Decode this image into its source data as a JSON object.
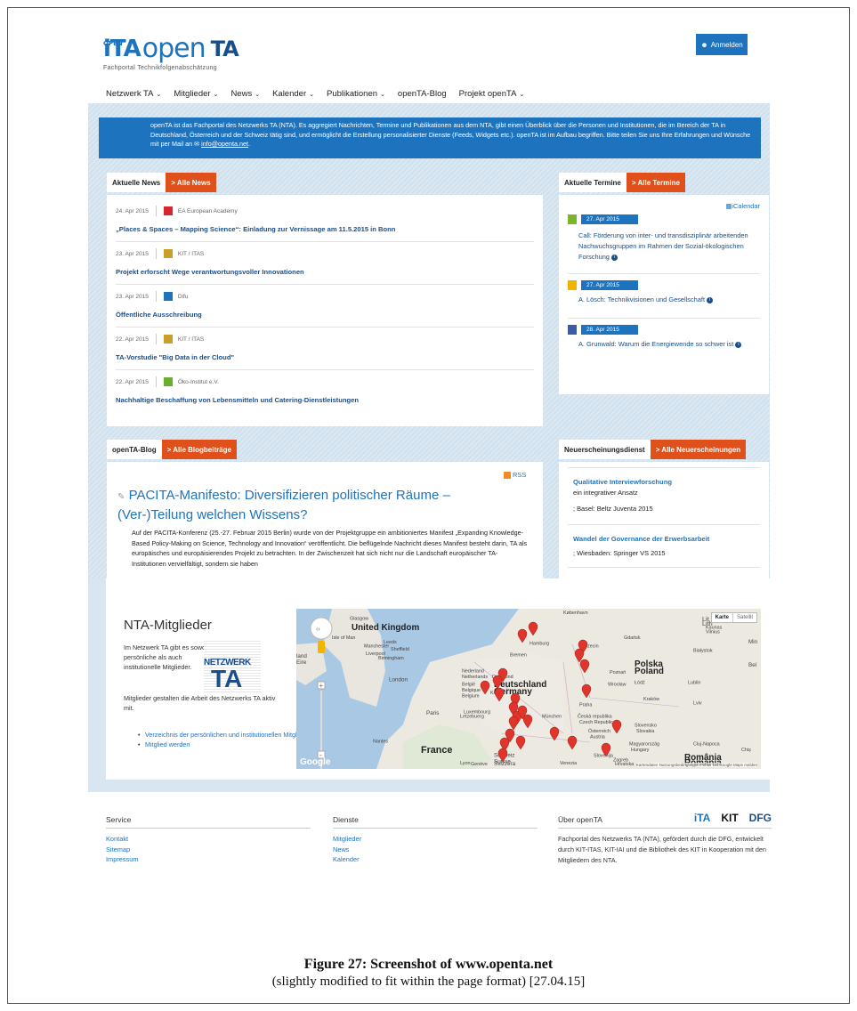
{
  "header": {
    "logo_small": "OPEN",
    "logo_ita": "iTA",
    "logo_open": "open",
    "logo_ta": "TA",
    "logo_sub": "Fachportal Technikfolgenabschätzung",
    "login_label": "Anmelden",
    "login_icon": "user-icon"
  },
  "nav": [
    {
      "label": "Netzwerk TA",
      "dropdown": true
    },
    {
      "label": "Mitglieder",
      "dropdown": true
    },
    {
      "label": "News",
      "dropdown": true
    },
    {
      "label": "Kalender",
      "dropdown": true
    },
    {
      "label": "Publikationen",
      "dropdown": true
    },
    {
      "label": "openTA-Blog",
      "dropdown": false
    },
    {
      "label": "Projekt openTA",
      "dropdown": true
    }
  ],
  "intro": {
    "text": "openTA ist das Fachportal des Netzwerks TA (NTA). Es aggregiert Nachrichten, Termine und Publikationen aus dem NTA, gibt einen Überblick über die Personen und Institutionen, die im Bereich der TA in Deutschland, Österreich und der Schweiz tätig sind, und ermöglicht die Erstellung personalisierter Dienste (Feeds, Widgets etc.). openTA ist im Aufbau begriffen. Bitte teilen Sie uns Ihre Erfahrungen und Wünsche mit per Mail an",
    "mail": "info@openta.net",
    "end": "."
  },
  "news": {
    "tab_label": "Aktuelle News",
    "tab_link": "> Alle News",
    "items": [
      {
        "date": "24. Apr 2015",
        "source": "EA European Academy",
        "title": "„Places & Spaces – Mapping Science“: Einladung zur Vernissage am 11.5.2015 in Bonn",
        "icon_color": "#d8262f"
      },
      {
        "date": "23. Apr 2015",
        "source": "KIT / ITAS",
        "title": "Projekt erforscht Wege verantwortungsvoller Innovationen",
        "icon_color": "#c8a028"
      },
      {
        "date": "23. Apr 2015",
        "source": "Difu",
        "title": "Öffentliche Ausschreibung",
        "icon_color": "#1e73be"
      },
      {
        "date": "22. Apr 2015",
        "source": "KIT / ITAS",
        "title": "TA-Vorstudie \"Big Data in der Cloud\"",
        "icon_color": "#c8a028"
      },
      {
        "date": "22. Apr 2015",
        "source": "Öko-Institut e.V.",
        "title": "Nachhaltige Beschaffung von Lebensmitteln und Catering-Dienstleistungen",
        "icon_color": "#6aae2e"
      }
    ]
  },
  "termine": {
    "tab_label": "Aktuelle Termine",
    "tab_link": "> Alle Termine",
    "ical": "iCalendar",
    "items": [
      {
        "date": "27. Apr 2015",
        "color": "#7db52a",
        "text": "Call: Förderung von inter- und transdisziplinär arbeitenden Nachwuchsgruppen im Rahmen der Sozial-ökologischen Forschung"
      },
      {
        "date": "27. Apr 2015",
        "color": "#f0b400",
        "text": "A. Lösch: Technikvisionen und Gesellschaft"
      },
      {
        "date": "28. Apr 2015",
        "color": "#3b5ba8",
        "text": "A. Grunwald: Warum die Energiewende so schwer ist"
      }
    ]
  },
  "blog": {
    "tab_label": "openTA-Blog",
    "tab_link": "> Alle Blogbeiträge",
    "rss": "RSS",
    "title": "PACITA-Manifesto: Diversifizieren politischer Räume – (Ver-)Teilung welchen Wissens?",
    "body": "Auf der PACITA-Konferenz (25.-27. Februar 2015 Berlin) wurde von der Projektgruppe ein ambitioniertes Manifest „Expanding Knowledge-Based Policy-Making on Science, Technology and Innovation“ veröffentlicht. Die beflügelnde Nachricht dieses Manifest besteht darin, TA als europäisches und europäisierendes Projekt zu betrachten. In der Zwischenzeit hat sich nicht nur die Landschaft europäischer TA-Institutionen vervielfältigt, sondern sie haben"
  },
  "pubs": {
    "tab_label": "Neuerscheinungsdienst",
    "tab_link": "> Alle Neuerscheinungen",
    "items": [
      {
        "title": "Qualitative Interviewforschung",
        "sub": "ein integrativer Ansatz",
        "pub": "; Basel: Beltz Juventa 2015"
      },
      {
        "title": "Wandel der Governance der Erwerbsarbeit",
        "sub": "",
        "pub": "; Wiesbaden: Springer VS 2015"
      }
    ]
  },
  "members": {
    "title": "NTA-Mitglieder",
    "text1": "Im Netzwerk TA gibt es sowohl persönliche als auch institutionelle Mitglieder.",
    "text2": "Mitglieder gestalten die Arbeit des Netzwerks TA aktiv mit.",
    "logo_w1": "NETZWERK",
    "logo_w2": "TA",
    "links": [
      "Verzeichnis der persönlichen und institutionellen Mitgliedern",
      "Mitglied werden"
    ]
  },
  "map": {
    "type_karte": "Karte",
    "type_satellit": "Satellit",
    "labels": [
      {
        "text": "Glasgow"
      },
      {
        "text": "United Kingdom"
      },
      {
        "text": "Isle of Man"
      },
      {
        "text": "Leeds"
      },
      {
        "text": "Manchester"
      },
      {
        "text": "Sheffield"
      },
      {
        "text": "Liverpool"
      },
      {
        "text": "Birmingham"
      },
      {
        "text": "Eire"
      },
      {
        "text": "land"
      },
      {
        "text": "London"
      },
      {
        "text": "Nederland"
      },
      {
        "text": "Netherlands"
      },
      {
        "text": "België"
      },
      {
        "text": "Belgique"
      },
      {
        "text": "Belgium"
      },
      {
        "text": "Luxembourg"
      },
      {
        "text": "Letzebuerg"
      },
      {
        "text": "Paris"
      },
      {
        "text": "Nantes"
      },
      {
        "text": "France"
      },
      {
        "text": "Lyon"
      },
      {
        "text": "Genève"
      },
      {
        "text": "Schweiz"
      },
      {
        "text": "Suisse"
      },
      {
        "text": "Svizzera"
      },
      {
        "text": "Bremen"
      },
      {
        "text": "Hamburg"
      },
      {
        "text": "Dortmund"
      },
      {
        "text": "Köln"
      },
      {
        "text": "Deutschland"
      },
      {
        "text": "Germany"
      },
      {
        "text": "München"
      },
      {
        "text": "Praha"
      },
      {
        "text": "Česká republika"
      },
      {
        "text": "Czech Republic"
      },
      {
        "text": "Österreich"
      },
      {
        "text": "Austria"
      },
      {
        "text": "Slovensko"
      },
      {
        "text": "Slovakia"
      },
      {
        "text": "Magyarország"
      },
      {
        "text": "Hungary"
      },
      {
        "text": "Polska"
      },
      {
        "text": "Poland"
      },
      {
        "text": "Szczecin"
      },
      {
        "text": "Gdańsk"
      },
      {
        "text": "Poznań"
      },
      {
        "text": "Wrocław"
      },
      {
        "text": "Łódź"
      },
      {
        "text": "Kraków"
      },
      {
        "text": "Lublin"
      },
      {
        "text": "Białystok"
      },
      {
        "text": "København"
      },
      {
        "text": "Kaunas"
      },
      {
        "text": "Vilnius"
      },
      {
        "text": "Lviv"
      },
      {
        "text": "Cluj-Napoca"
      },
      {
        "text": "România"
      },
      {
        "text": "Romania"
      },
      {
        "text": "Zagreb"
      },
      {
        "text": "Slovenija"
      },
      {
        "text": "Venezia"
      },
      {
        "text": "Hrvatska"
      },
      {
        "text": "Chiș"
      },
      {
        "text": "Bel"
      },
      {
        "text": "Min"
      },
      {
        "text": "Lit"
      },
      {
        "text": "Lith"
      }
    ],
    "footer_text": "Kartendaten  Nutzungsbedingungen  Fehler bei Google Maps melden",
    "google": "Google"
  },
  "footer": {
    "service": {
      "head": "Service",
      "links": [
        "Kontakt",
        "Sitemap",
        "Impressum"
      ]
    },
    "dienste": {
      "head": "Dienste",
      "links": [
        "Mitglieder",
        "News",
        "Kalender"
      ]
    },
    "about": {
      "head": "Über openTA",
      "text": "Fachportal des Netzwerks TA (NTA), gefördert durch die DFG, entwickelt durch KIT-ITAS, KIT-IAI und die Bibliothek des KIT in Kooperation mit den Mitgliedern des NTA.",
      "logo1": "iTA",
      "logo2": "KIT",
      "logo3": "DFG"
    }
  },
  "caption": {
    "line1": "Figure 27: Screenshot of www.openta.net",
    "line2": "(slightly modified to fit within the page format) [27.04.15]"
  }
}
